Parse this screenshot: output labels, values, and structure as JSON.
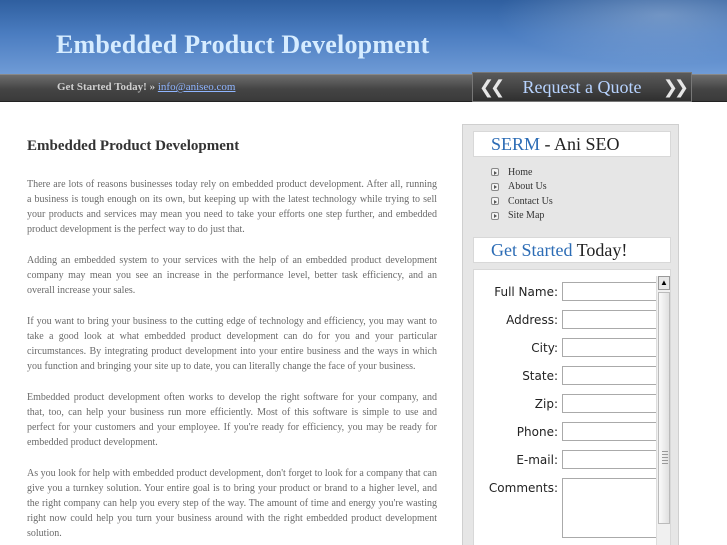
{
  "header": {
    "title": "Embedded Product Development"
  },
  "navbar": {
    "get_started_text": "Get Started Today! »",
    "email": "info@aniseo.com"
  },
  "quote": {
    "label": "Request a Quote",
    "left_icon": "double-chevron-left-icon",
    "right_icon": "double-chevron-right-icon"
  },
  "article": {
    "heading": "Embedded Product Development",
    "paragraphs": [
      "There are lots of reasons businesses today rely on embedded product development. After all, running a business is tough enough on its own, but keeping up with the latest technology while trying to sell your products and services may mean you need to take your efforts one step further, and embedded product development is the perfect way to do just that.",
      "Adding an embedded system to your services with the help of an embedded product development company may mean you see an increase in the performance level, better task efficiency, and an overall increase your sales.",
      "If you want to bring your business to the cutting edge of technology and efficiency, you may want to take a good look at what embedded product development can do for you and your particular circumstances. By integrating product development into your entire business and the ways in which you function and bringing your site up to date, you can literally change the face of your business.",
      "Embedded product development often works to develop the right software for your company, and that, too, can help your business run more efficiently. Most of this software is simple to use and perfect for your customers and your employee. If you're ready for efficiency, you may be ready for embedded product development.",
      "As you look for help with embedded product development, don't forget to look for a company that can give you a turnkey solution. Your entire goal is to bring your product or brand to a higher level, and the right company can help you every step of the way. The amount of time and energy you're wasting right now could help you turn your business around with the right embedded product development solution."
    ]
  },
  "sidebar": {
    "serm_title_accent": "SERM",
    "serm_title_rest": " - Ani SEO",
    "nav": [
      {
        "label": "Home"
      },
      {
        "label": "About Us"
      },
      {
        "label": "Contact Us"
      },
      {
        "label": "Site Map"
      }
    ],
    "get_started_accent": "Get Started",
    "get_started_rest": " Today!",
    "form": {
      "full_name": "Full Name:",
      "address": "Address:",
      "city": "City:",
      "state": "State:",
      "zip": "Zip:",
      "phone": "Phone:",
      "email": "E-mail:",
      "comments": "Comments:"
    }
  }
}
